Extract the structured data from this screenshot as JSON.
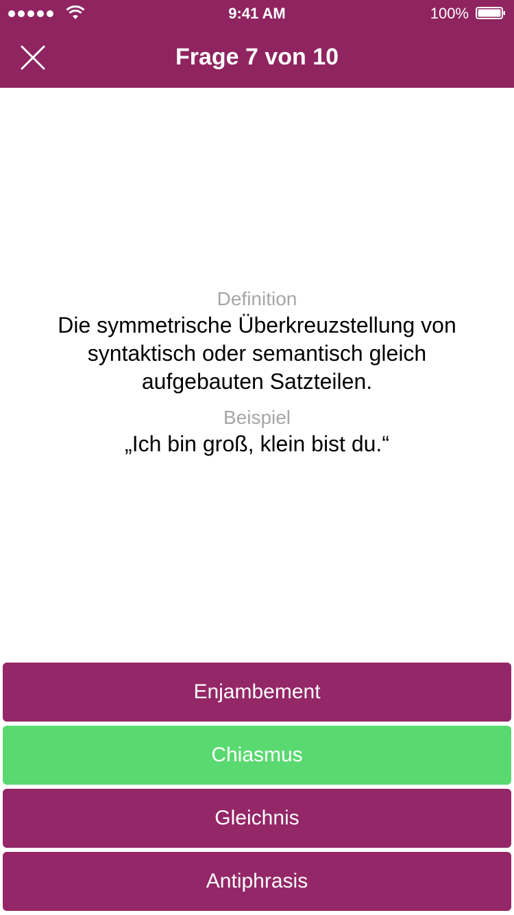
{
  "status_bar": {
    "time": "9:41 AM",
    "battery_percent": "100%",
    "signal_bars": 5,
    "battery_level": 1.0
  },
  "header": {
    "title": "Frage 7 von 10",
    "close_icon": "close-icon",
    "background_color": "#8f2460"
  },
  "question": {
    "definition_label": "Definition",
    "definition_text": "Die symmetrische Überkreuzstellung von syntaktisch oder semantisch gleich aufgebauten Satzteilen.",
    "example_label": "Beispiel",
    "example_text": "„Ich bin groß, klein bist du.“"
  },
  "answers": [
    {
      "label": "Enjambement",
      "state": "default"
    },
    {
      "label": "Chiasmus",
      "state": "correct"
    },
    {
      "label": "Gleichnis",
      "state": "default"
    },
    {
      "label": "Antiphrasis",
      "state": "default"
    }
  ],
  "colors": {
    "accent": "#942767",
    "correct": "#5ad971",
    "label_gray": "#a6a6a6"
  }
}
